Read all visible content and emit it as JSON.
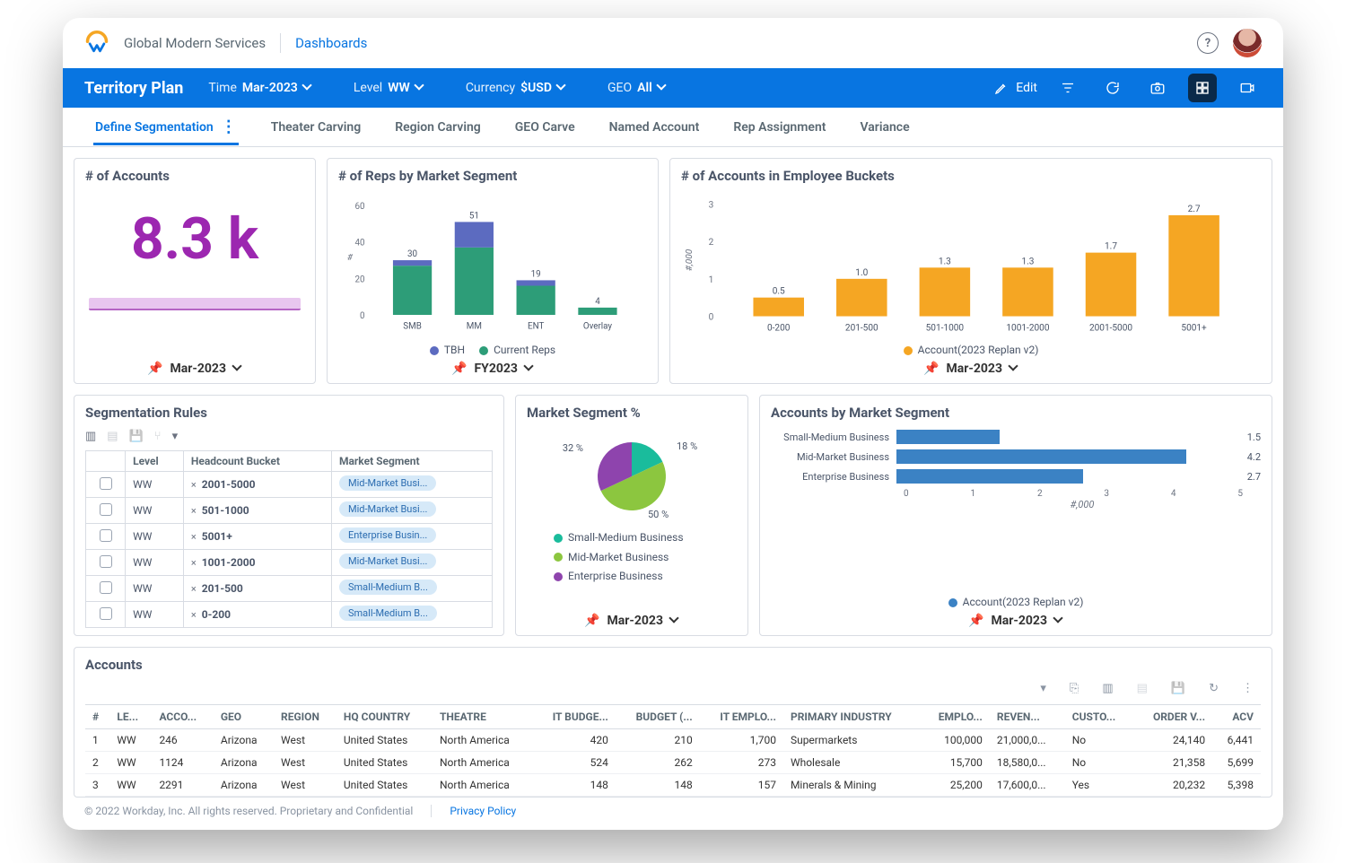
{
  "topbar": {
    "org": "Global Modern Services",
    "crumb": "Dashboards",
    "help_glyph": "?"
  },
  "header": {
    "title": "Territory Plan",
    "filters": [
      {
        "label": "Time",
        "value": "Mar-2023"
      },
      {
        "label": "Level",
        "value": "WW"
      },
      {
        "label": "Currency",
        "value": "$USD"
      },
      {
        "label": "GEO",
        "value": "All"
      }
    ],
    "edit_label": "Edit"
  },
  "tabs": [
    "Define Segmentation",
    "Theater Carving",
    "Region Carving",
    "GEO Carve",
    "Named Account",
    "Rep Assignment",
    "Variance"
  ],
  "active_tab": 0,
  "cards": {
    "accounts_count": {
      "title": "# of Accounts",
      "value": "8.3 k",
      "footer": "Mar-2023"
    },
    "reps_by_segment": {
      "title": "# of Reps by Market Segment",
      "footer": "FY2023",
      "legend": [
        "TBH",
        "Current Reps"
      ]
    },
    "accounts_emp_buckets": {
      "title": "# of Accounts in Employee Buckets",
      "footer": "Mar-2023",
      "legend": [
        "Account(2023 Replan v2)"
      ]
    },
    "segmentation_rules": {
      "title": "Segmentation Rules",
      "columns": [
        "",
        "Level",
        "Headcount Bucket",
        "Market Segment"
      ]
    },
    "market_segment_pct": {
      "title": "Market Segment %",
      "footer": "Mar-2023"
    },
    "accounts_by_segment": {
      "title": "Accounts by Market Segment",
      "footer": "Mar-2023",
      "legend": [
        "Account(2023 Replan v2)"
      ],
      "xlabel": "#,000"
    },
    "accounts_table": {
      "title": "Accounts"
    }
  },
  "chart_data": {
    "reps_by_segment": {
      "type": "bar-stacked",
      "ylabel": "#",
      "ylim": [
        0,
        60
      ],
      "yticks": [
        0,
        20,
        40,
        60
      ],
      "categories": [
        "SMB",
        "MM",
        "ENT",
        "Overlay"
      ],
      "totals": [
        30,
        51,
        19,
        4
      ],
      "series": [
        {
          "name": "Current Reps",
          "color": "#2d9d78",
          "values": [
            27,
            37,
            16,
            4
          ]
        },
        {
          "name": "TBH",
          "color": "#5c6bc0",
          "values": [
            3,
            14,
            3,
            0
          ]
        }
      ]
    },
    "accounts_emp_buckets": {
      "type": "bar",
      "ylabel": "#,000",
      "ylim": [
        0,
        3
      ],
      "yticks": [
        0,
        1,
        2,
        3
      ],
      "categories": [
        "0-200",
        "201-500",
        "501-1000",
        "1001-2000",
        "2001-5000",
        "5001+"
      ],
      "values": [
        0.5,
        1.0,
        1.3,
        1.3,
        1.7,
        2.7
      ],
      "color": "#f5a623"
    },
    "market_segment_pct": {
      "type": "pie",
      "slices": [
        {
          "name": "Small-Medium Business",
          "value": 18,
          "color": "#1abc9c"
        },
        {
          "name": "Mid-Market Business",
          "value": 50,
          "color": "#8cc63f"
        },
        {
          "name": "Enterprise Business",
          "value": 32,
          "color": "#8e44ad"
        }
      ]
    },
    "accounts_by_segment": {
      "type": "bar-horizontal",
      "xlabel": "#,000",
      "xlim": [
        0,
        5
      ],
      "xticks": [
        0,
        1,
        2,
        3,
        4,
        5
      ],
      "categories": [
        "Small-Medium Business",
        "Mid-Market Business",
        "Enterprise Business"
      ],
      "values": [
        1.5,
        4.2,
        2.7
      ],
      "color": "#3b82c4"
    }
  },
  "segmentation_rows": [
    {
      "level": "WW",
      "bucket": "2001-5000",
      "segment": "Mid-Market Busi..."
    },
    {
      "level": "WW",
      "bucket": "501-1000",
      "segment": "Mid-Market Busi..."
    },
    {
      "level": "WW",
      "bucket": "5001+",
      "segment": "Enterprise Busin..."
    },
    {
      "level": "WW",
      "bucket": "1001-2000",
      "segment": "Mid-Market Busi..."
    },
    {
      "level": "WW",
      "bucket": "201-500",
      "segment": "Small-Medium B..."
    },
    {
      "level": "WW",
      "bucket": "0-200",
      "segment": "Small-Medium B..."
    }
  ],
  "accounts_columns": [
    "#",
    "LE...",
    "ACCO...",
    "GEO",
    "REGION",
    "HQ COUNTRY",
    "THEATRE",
    "IT BUDGE...",
    "BUDGET (...",
    "IT EMPLO...",
    "PRIMARY INDUSTRY",
    "EMPLO...",
    "REVEN...",
    "CUSTO...",
    "ORDER V...",
    "ACV"
  ],
  "accounts_rows": [
    {
      "n": 1,
      "le": "WW",
      "acco": "246",
      "geo": "Arizona",
      "region": "West",
      "hq": "United States",
      "theatre": "North America",
      "itb": 420,
      "bud": 210,
      "ite": "1,700",
      "ind": "Supermarkets",
      "emp": "100,000",
      "rev": "21,000,0...",
      "cust": "No",
      "ord": "24,140",
      "acv": "6,441"
    },
    {
      "n": 2,
      "le": "WW",
      "acco": "1124",
      "geo": "Arizona",
      "region": "West",
      "hq": "United States",
      "theatre": "North America",
      "itb": 524,
      "bud": 262,
      "ite": "273",
      "ind": "Wholesale",
      "emp": "15,700",
      "rev": "18,580,0...",
      "cust": "No",
      "ord": "21,358",
      "acv": "5,699"
    },
    {
      "n": 3,
      "le": "WW",
      "acco": "2291",
      "geo": "Arizona",
      "region": "West",
      "hq": "United States",
      "theatre": "North America",
      "itb": 148,
      "bud": 148,
      "ite": "157",
      "ind": "Minerals & Mining",
      "emp": "25,200",
      "rev": "17,600,0...",
      "cust": "Yes",
      "ord": "20,232",
      "acv": "5,398"
    }
  ],
  "footer": {
    "copyright": "© 2022 Workday, Inc. All rights reserved. Proprietary and Confidential",
    "privacy": "Privacy Policy"
  }
}
